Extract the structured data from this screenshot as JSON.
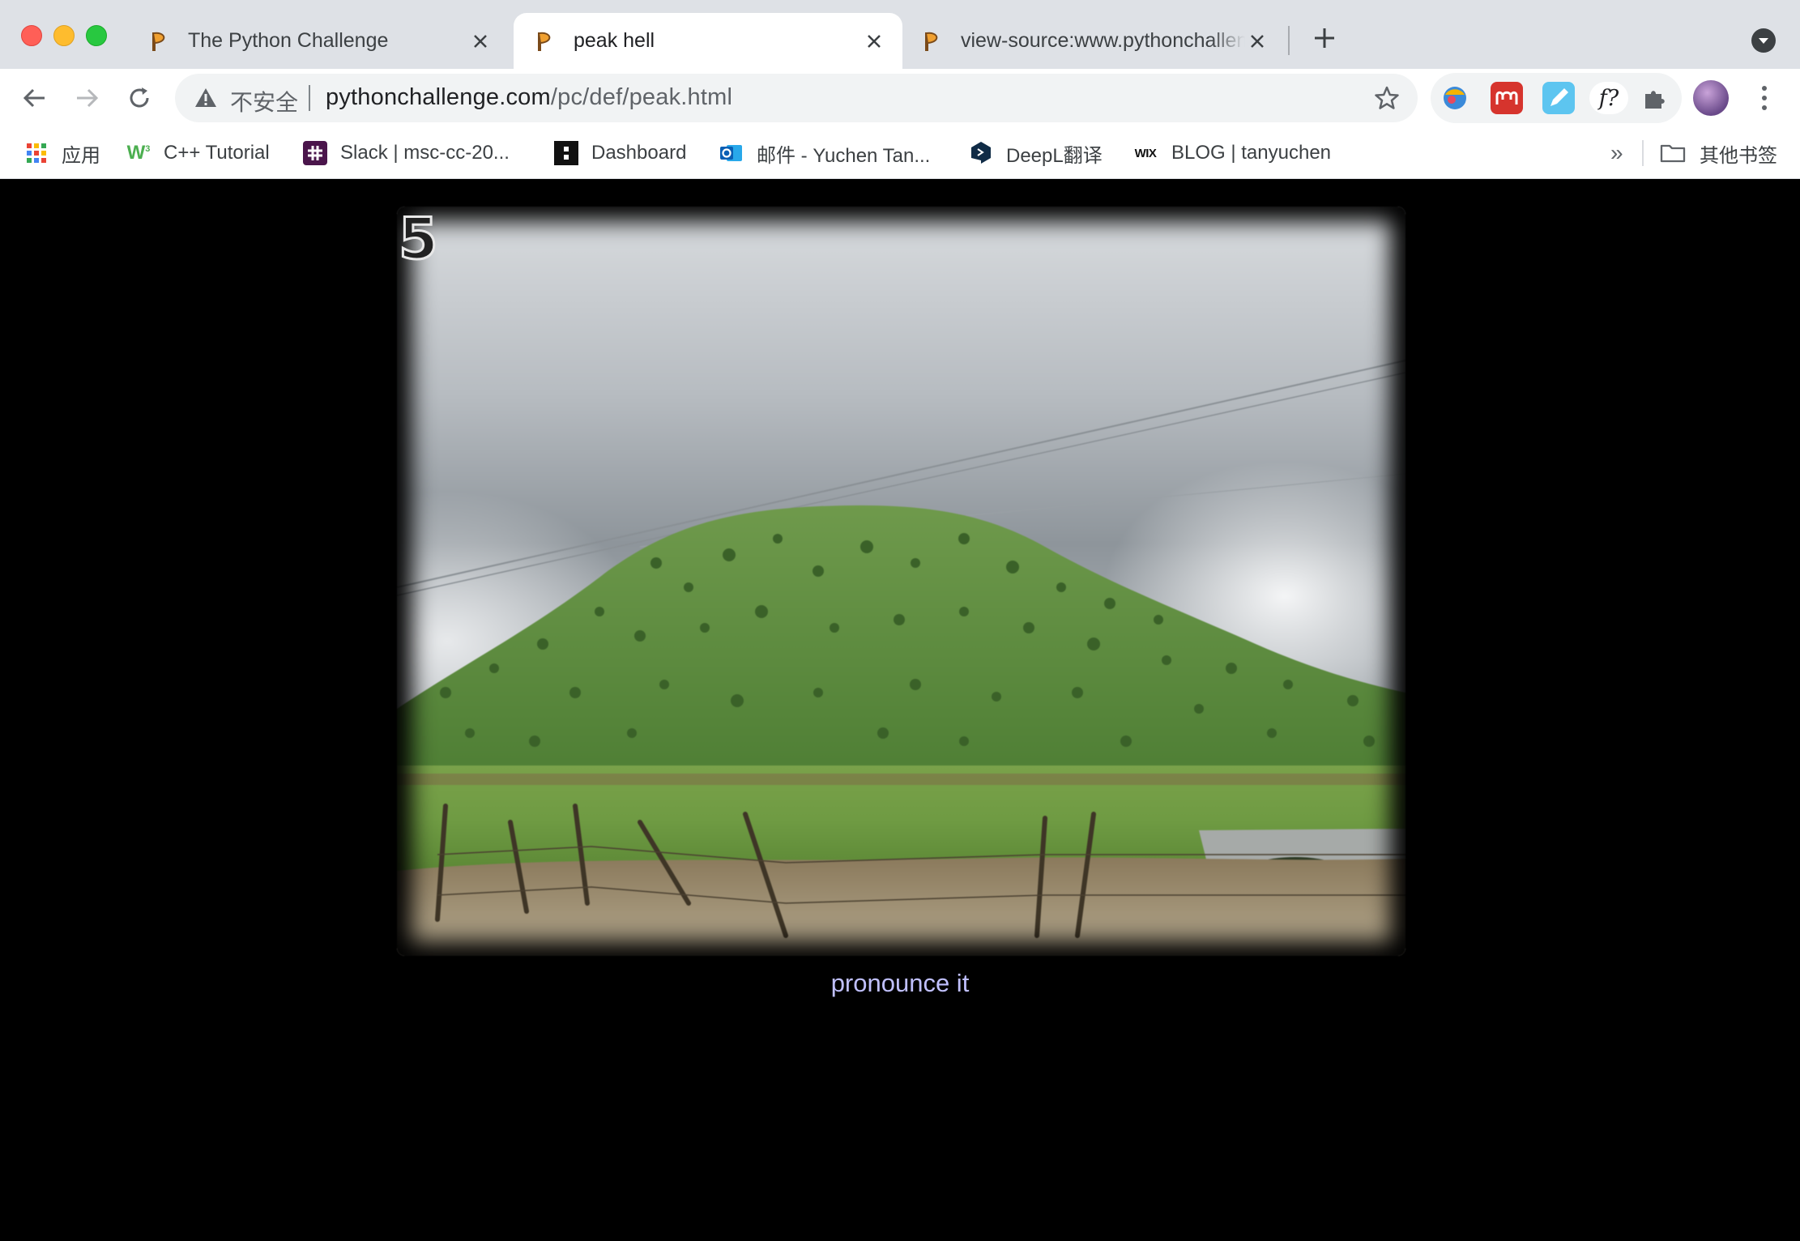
{
  "browser": {
    "tabs": [
      {
        "title": "The Python Challenge",
        "active": false
      },
      {
        "title": "peak hell",
        "active": true
      },
      {
        "title": "view-source:www.pythonchallenge.com/pc/def/peak.html",
        "active": false
      }
    ],
    "omnibox": {
      "security_label": "不安全",
      "url_host": "pythonchallenge.com",
      "url_path": "/pc/def/peak.html"
    },
    "bookmarks": [
      {
        "label": "应用",
        "icon": "apps-grid-icon"
      },
      {
        "label": "C++ Tutorial",
        "icon": "w3schools-icon"
      },
      {
        "label": "Slack | msc-cc-20...",
        "icon": "slack-icon"
      },
      {
        "label": "Dashboard",
        "icon": "dashboard-icon"
      },
      {
        "label": "邮件 - Yuchen Tan...",
        "icon": "outlook-icon"
      },
      {
        "label": "DeepL翻译",
        "icon": "deepl-icon"
      },
      {
        "label": "BLOG | tanyuchen",
        "icon": "wix-icon"
      }
    ],
    "bookmarks_overflow": "»",
    "other_bookmarks": "其他书签",
    "extensions": [
      "colorful-extension-icon",
      "mendeley-icon",
      "pen-extension-icon",
      "formula-extension-icon",
      "puzzle-icon"
    ]
  },
  "page": {
    "level_number": "5",
    "caption": "pronounce it",
    "colors": {
      "background": "#000000",
      "caption": "#c0c0ff"
    }
  }
}
